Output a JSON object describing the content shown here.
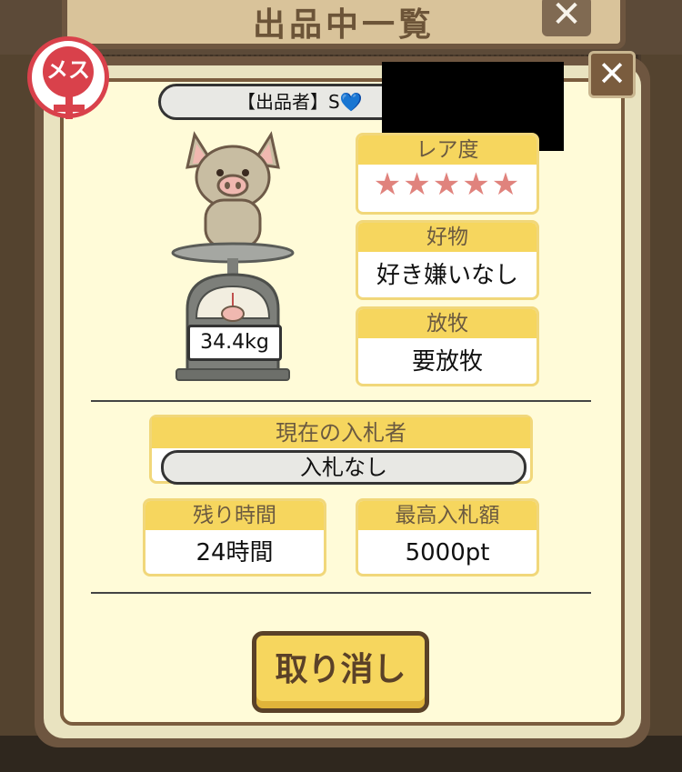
{
  "background": {
    "title": "出品中一覧",
    "close_icon": "close-icon"
  },
  "modal": {
    "gender_badge": "メス",
    "seller": "【出品者】S💙",
    "close_label": "✕",
    "rarity": {
      "label": "レア度",
      "stars": "★★★★★",
      "star_count": 5
    },
    "favorite_food": {
      "label": "好物",
      "value": "好き嫌いなし"
    },
    "grazing": {
      "label": "放牧",
      "value": "要放牧"
    },
    "weight": "34.4kg",
    "current_bidder": {
      "label": "現在の入札者",
      "value": "入札なし"
    },
    "time_left": {
      "label": "残り時間",
      "value": "24時間"
    },
    "max_bid": {
      "label": "最高入札額",
      "value": "5000pt"
    },
    "cancel_button": "取り消し"
  },
  "colors": {
    "accent_yellow": "#f6d65e",
    "frame_brown": "#7a5c3e",
    "female_red": "#d9414b",
    "star_pink": "#e0837d"
  }
}
